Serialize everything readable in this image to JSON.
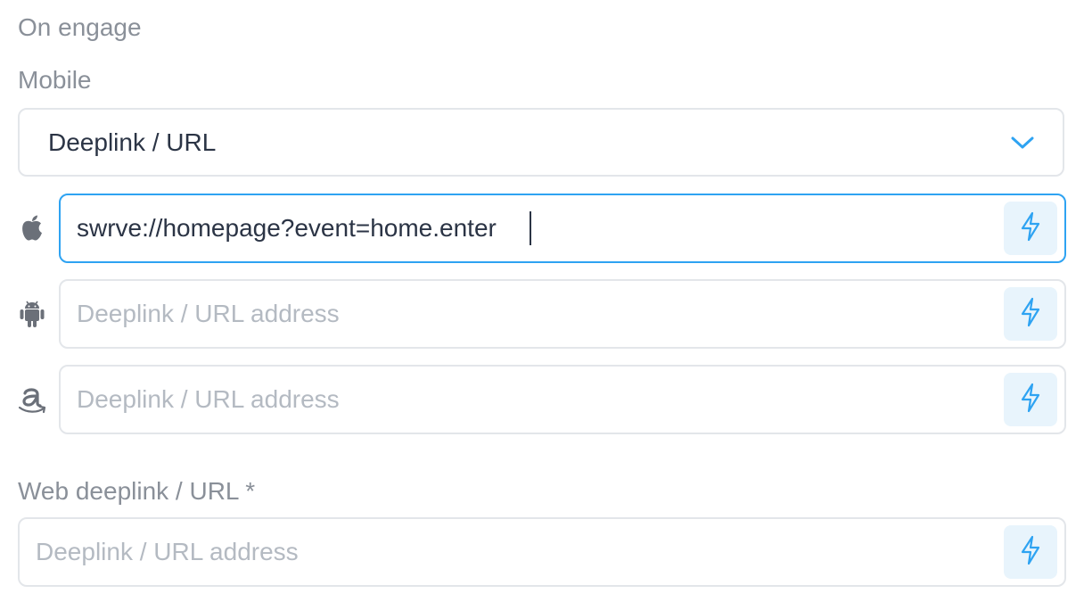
{
  "section_title": "On engage",
  "mobile": {
    "label": "Mobile",
    "action_select": {
      "value": "Deeplink / URL"
    },
    "ios": {
      "icon": "apple-icon",
      "value": "swrve://homepage?event=home.enter",
      "placeholder": "Deeplink / URL address"
    },
    "android": {
      "icon": "android-icon",
      "value": "",
      "placeholder": "Deeplink / URL address"
    },
    "amazon": {
      "icon": "amazon-icon",
      "value": "",
      "placeholder": "Deeplink / URL address"
    }
  },
  "web": {
    "label": "Web deeplink / URL *",
    "value": "",
    "placeholder": "Deeplink / URL address"
  },
  "colors": {
    "accent": "#2ea3f2",
    "bolt_bg": "#e8f4fc",
    "label": "#8a9099"
  }
}
